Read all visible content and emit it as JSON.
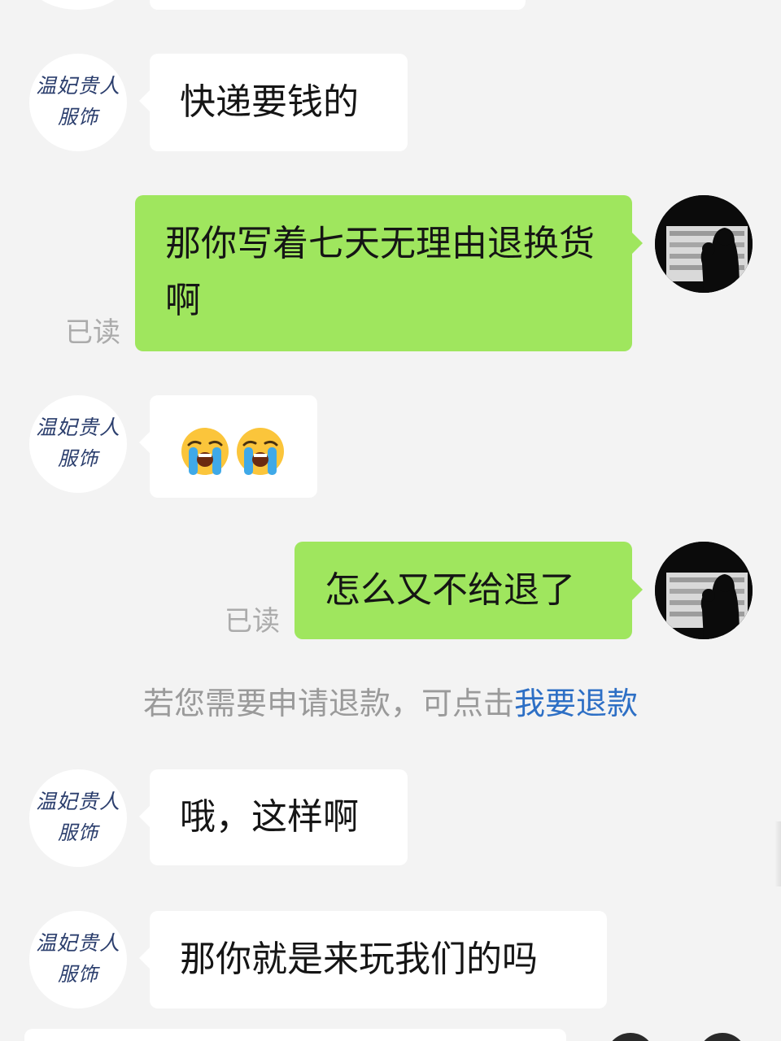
{
  "chat": {
    "shop_avatar_text": [
      "温妃贵人",
      "服饰"
    ],
    "read_label": "已读",
    "messages": [
      {
        "side": "in",
        "text": "快递要钱的"
      },
      {
        "side": "out",
        "text": "那你写着七天无理由退换货啊",
        "status": "已读"
      },
      {
        "side": "in",
        "emojis": [
          "loudly-crying-face",
          "loudly-crying-face"
        ]
      },
      {
        "side": "out",
        "text": "怎么又不给退了",
        "status": "已读"
      },
      {
        "side": "in",
        "text": "哦，这样啊"
      },
      {
        "side": "in",
        "text": "那你就是来玩我们的吗"
      }
    ],
    "system_notice": {
      "prefix": "若您需要申请退款，可点击",
      "link": "我要退款"
    }
  },
  "colors": {
    "background": "#f3f3f3",
    "outgoing_bubble": "#9fe65e",
    "incoming_bubble": "#ffffff",
    "read_status": "#ababab",
    "system_text": "#9a9a9a",
    "link": "#2d6fc5",
    "shop_logo_text": "#2b3e6d"
  }
}
